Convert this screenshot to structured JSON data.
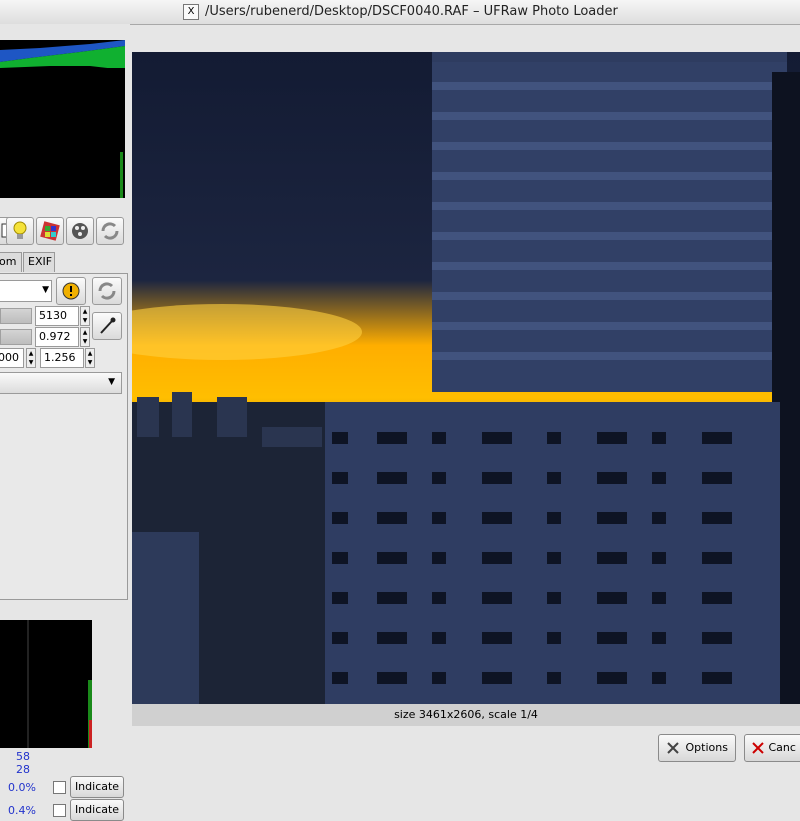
{
  "window": {
    "title": "/Users/rubenerd/Desktop/DSCF0040.RAF – UFRaw Photo Loader",
    "x_glyph": "X"
  },
  "tabs": [
    {
      "label": "om"
    },
    {
      "label": "EXIF"
    }
  ],
  "white_balance": {
    "preset_arrow": "▼",
    "temperature": "5130",
    "green": "0.972",
    "left_value": "000",
    "chan_multiplier": "1.256"
  },
  "raw_histogram": {
    "value1": "58",
    "value2": "28"
  },
  "indicators": [
    {
      "percent": "0.0%",
      "button": "Indicate"
    },
    {
      "percent": "0.4%",
      "button": "Indicate"
    }
  ],
  "preview": {
    "status": "size 3461x2606, scale 1/4"
  },
  "buttons": {
    "options": "Options",
    "cancel": "Canc"
  },
  "colors": {
    "window_bg": "#e6e6e6",
    "status_blue": "#2233cc",
    "sky": "#141c2e",
    "sunset": "#ffb400"
  }
}
